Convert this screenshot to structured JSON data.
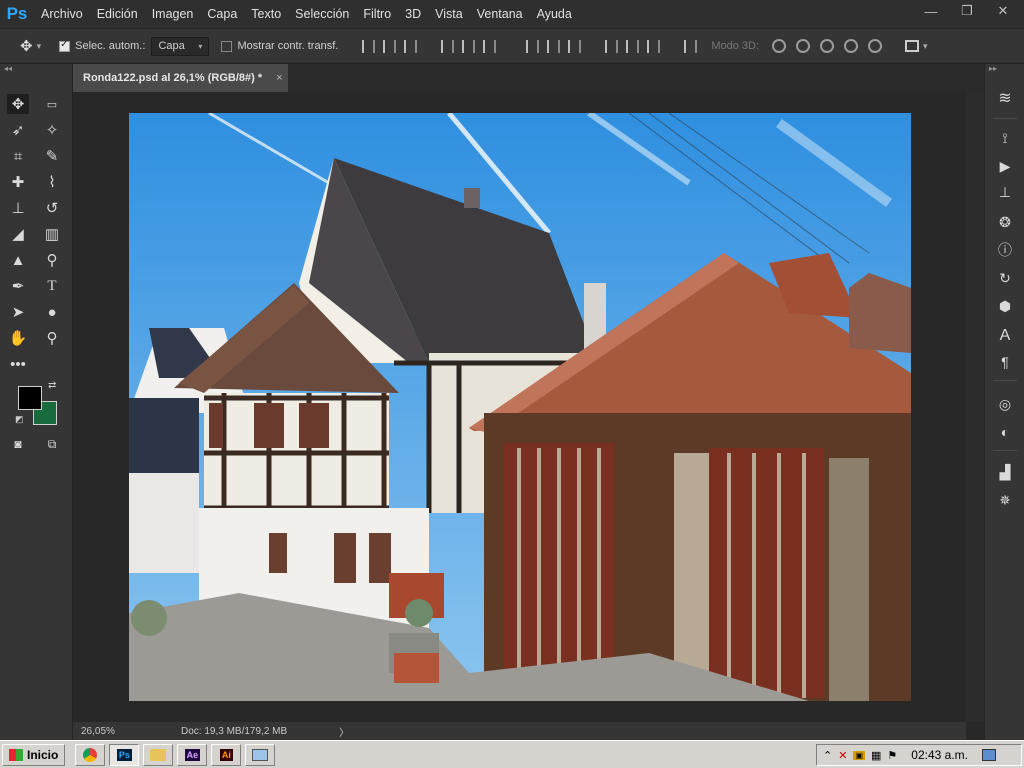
{
  "app": {
    "logo": "Ps"
  },
  "menu": [
    "Archivo",
    "Edición",
    "Imagen",
    "Capa",
    "Texto",
    "Selección",
    "Filtro",
    "3D",
    "Vista",
    "Ventana",
    "Ayuda"
  ],
  "window_controls": {
    "minimize": "—",
    "restore": "❐",
    "close": "✕"
  },
  "options": {
    "auto_select_label": "Selec. autom.:",
    "auto_select_value": "Capa",
    "show_transform_label": "Mostrar contr. transf.",
    "mode3d_label": "Modo 3D:"
  },
  "document": {
    "tab_title": "Ronda122.psd al 26,1% (RGB/8#) *",
    "tab_close": "×",
    "zoom": "26,05%",
    "doc_info": "Doc: 19,3 MB/179,2 MB",
    "info_arrow": "〉"
  },
  "colors": {
    "foreground": "#000000",
    "background": "#186b3d",
    "accent": "#31a8ff"
  },
  "tools": [
    "move-tool",
    "artboard-tool",
    "lasso-tool",
    "magic-wand-tool",
    "crop-tool",
    "eyedropper-tool",
    "healing-brush-tool",
    "brush-tool",
    "clone-stamp-tool",
    "history-brush-tool",
    "eraser-tool",
    "gradient-tool",
    "sharpen-tool",
    "dodge-tool",
    "pen-tool",
    "type-tool",
    "path-selection-tool",
    "ellipse-tool",
    "hand-tool",
    "zoom-tool"
  ],
  "right_panels": [
    "layers-icon",
    "paths-icon",
    "actions-icon",
    "clone-source-icon",
    "channels-icon",
    "info-icon",
    "history-icon",
    "3d-icon",
    "character-icon",
    "paragraph-icon",
    "adjustments-icon",
    "styles-icon",
    "histogram-icon",
    "navigator-icon"
  ],
  "taskbar": {
    "start_label": "Inicio",
    "apps": [
      "chrome",
      "photoshop",
      "explorer",
      "after-effects",
      "illustrator",
      "paint"
    ],
    "clock": "02:43 a.m."
  }
}
